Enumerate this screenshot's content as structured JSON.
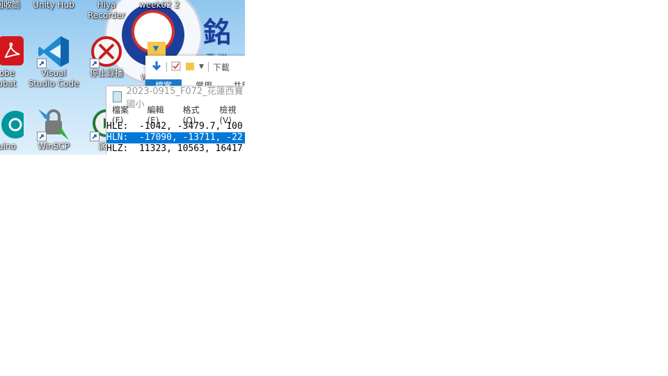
{
  "desktop": {
    "top_labels": [
      "回收筒",
      "Unity Hub",
      "Hiya\nRecorder",
      "week02 2"
    ],
    "icons": [
      {
        "label": "obe\nobat",
        "icon": "adobe-acrobat-icon"
      },
      {
        "label": "Visual\nStudio Code",
        "icon": "vscode-icon"
      },
      {
        "label": "停止錄播",
        "icon": "stop-record-icon"
      },
      {
        "label": "uino",
        "icon": "arduino-icon"
      },
      {
        "label": "WinSCP",
        "icon": "winscp-icon"
      },
      {
        "label": "演講",
        "icon": "play-icon"
      }
    ],
    "background_logo": {
      "text": "銘 亞 洲 傳 大 學"
    },
    "partial_label": "w"
  },
  "explorer": {
    "toolbar_path": "下載",
    "tabs": [
      "檔案",
      "常用",
      "共用"
    ]
  },
  "notepad": {
    "title": "2023-0915_F072_花蓮西寶國小",
    "menu": [
      "檔案(F)",
      "編輯(E)",
      "格式(O)",
      "檢視(V)"
    ],
    "lines": [
      {
        "text": "HLE:  -1042, -3479.7, 100",
        "selected": false
      },
      {
        "text": "HLN:  -17090, -13711, -22",
        "selected": true
      },
      {
        "text": "HLZ:  11323, 10563, 16417",
        "selected": false
      }
    ]
  }
}
